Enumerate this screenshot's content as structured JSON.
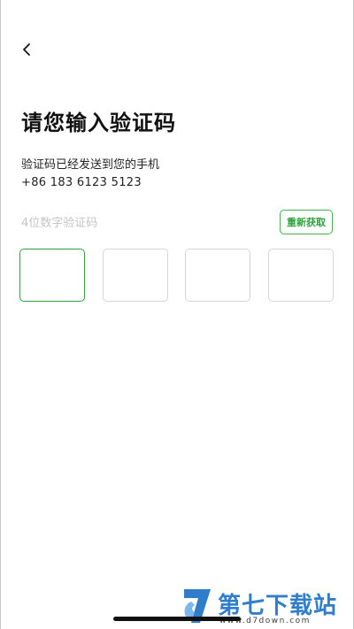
{
  "nav": {
    "back_icon": "chevron-left-icon"
  },
  "title": "请您输入验证码",
  "notice": {
    "line1": "验证码已经发送到您的手机",
    "phone": "+86 183 6123 5123"
  },
  "code_input": {
    "hint": "4位数字验证码",
    "resend_label": "重新获取",
    "box_count": 4,
    "active_index": 0,
    "digits": [
      "",
      "",
      "",
      ""
    ]
  },
  "colors": {
    "accent": "#2fa23d",
    "box_border": "#d6d6d6",
    "hint_text": "#c4c4c4",
    "watermark_blue": "#1f74c7"
  },
  "watermark": {
    "brand": "第七下载站",
    "url": "www.d7down.com"
  }
}
